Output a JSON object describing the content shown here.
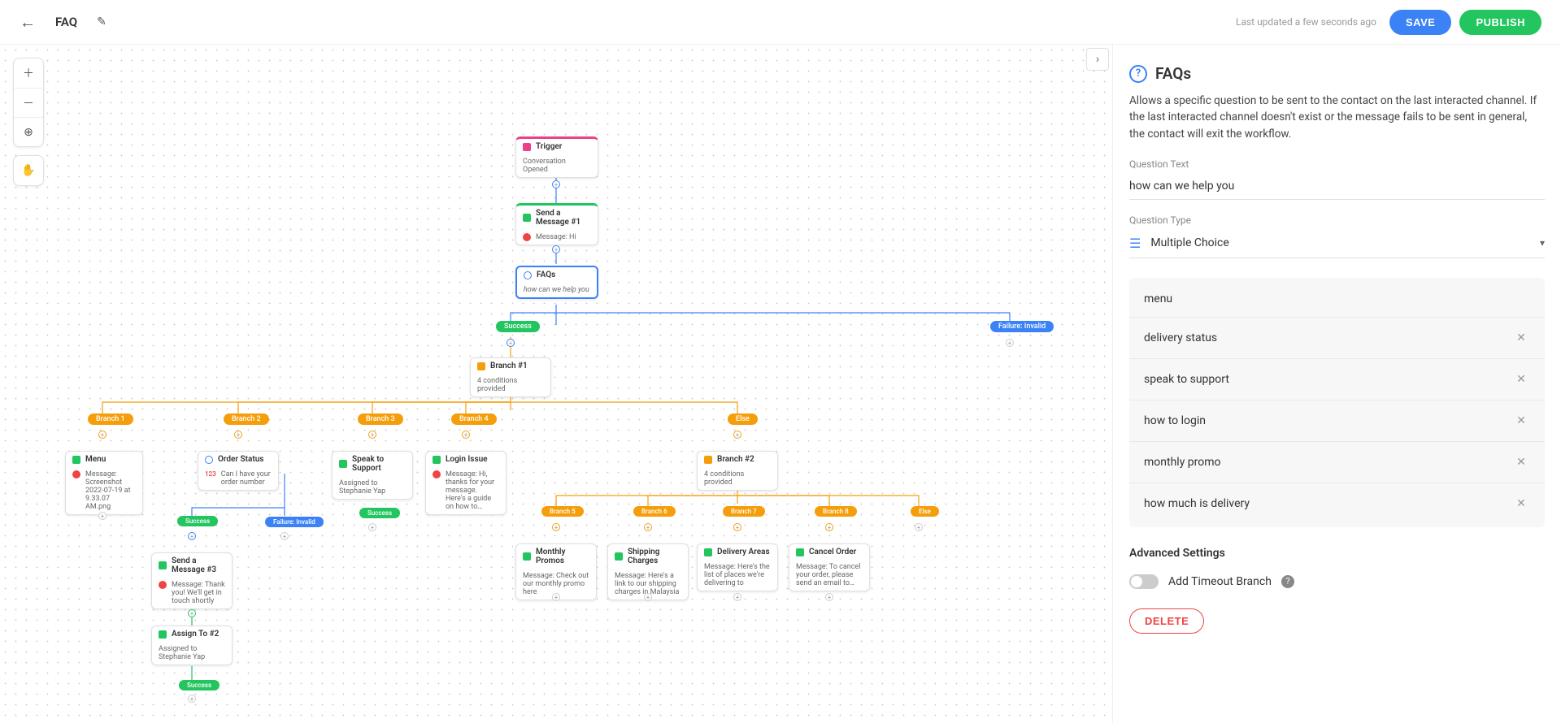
{
  "header": {
    "title": "FAQ",
    "updated": "Last updated a few seconds ago",
    "save_label": "SAVE",
    "publish_label": "PUBLISH"
  },
  "canvas_nodes": {
    "trigger": {
      "title": "Trigger",
      "sub": "Conversation Opened"
    },
    "msg1": {
      "title": "Send a Message #1",
      "body": "Message: Hi"
    },
    "faqs": {
      "title": "FAQs",
      "body": "how can we help you"
    },
    "branch1": {
      "title": "Branch #1",
      "body": "4 conditions provided"
    },
    "branch2": {
      "title": "Branch #2",
      "body": "4 conditions provided"
    },
    "menu": {
      "title": "Menu",
      "body": "Message: Screenshot 2022-07-19 at 9.33.07 AM.png"
    },
    "order_status": {
      "title": "Order Status",
      "body": "Can I have your order number"
    },
    "support": {
      "title": "Speak to Support",
      "body": "Assigned to Stephanie Yap"
    },
    "login": {
      "title": "Login Issue",
      "body": "Message: Hi, thanks for your message. Here's a guide on how to…"
    },
    "msg3": {
      "title": "Send a Message #3",
      "body": "Message: Thank you! We'll get in touch shortly"
    },
    "assign2": {
      "title": "Assign To #2",
      "body": "Assigned to Stephanie Yap"
    },
    "monthly": {
      "title": "Monthly Promos",
      "body": "Message: Check out our monthly promo here"
    },
    "shipping": {
      "title": "Shipping Charges",
      "body": "Message: Here's a link to our shipping charges in Malaysia"
    },
    "delivery": {
      "title": "Delivery Areas",
      "body": "Message: Here's the list of places we're delivering to"
    },
    "cancel": {
      "title": "Cancel Order",
      "body": "Message: To cancel your order, please send an email to…"
    }
  },
  "pills": {
    "success": "Success",
    "failure": "Failure: Invalid",
    "b1": "Branch 1",
    "b2": "Branch 2",
    "b3": "Branch 3",
    "b4": "Branch 4",
    "b5": "Branch 5",
    "b6": "Branch 6",
    "b7": "Branch 7",
    "b8": "Branch 8",
    "else": "Else"
  },
  "panel": {
    "title": "FAQs",
    "desc": "Allows a specific question to be sent to the contact on the last interacted channel. If the last interacted channel doesn't exist or the message fails to be sent in general, the contact will exit the workflow.",
    "q_label": "Question Text",
    "q_value": "how can we help you",
    "qtype_label": "Question Type",
    "qtype_value": "Multiple Choice",
    "options": [
      {
        "label": "menu",
        "removable": false
      },
      {
        "label": "delivery status",
        "removable": true
      },
      {
        "label": "speak to support",
        "removable": true
      },
      {
        "label": "how to login",
        "removable": true
      },
      {
        "label": "monthly promo",
        "removable": true
      },
      {
        "label": "how much is delivery",
        "removable": true
      }
    ],
    "adv_label": "Advanced Settings",
    "timeout_label": "Add Timeout Branch",
    "timeout_on": false,
    "delete_label": "DELETE"
  }
}
